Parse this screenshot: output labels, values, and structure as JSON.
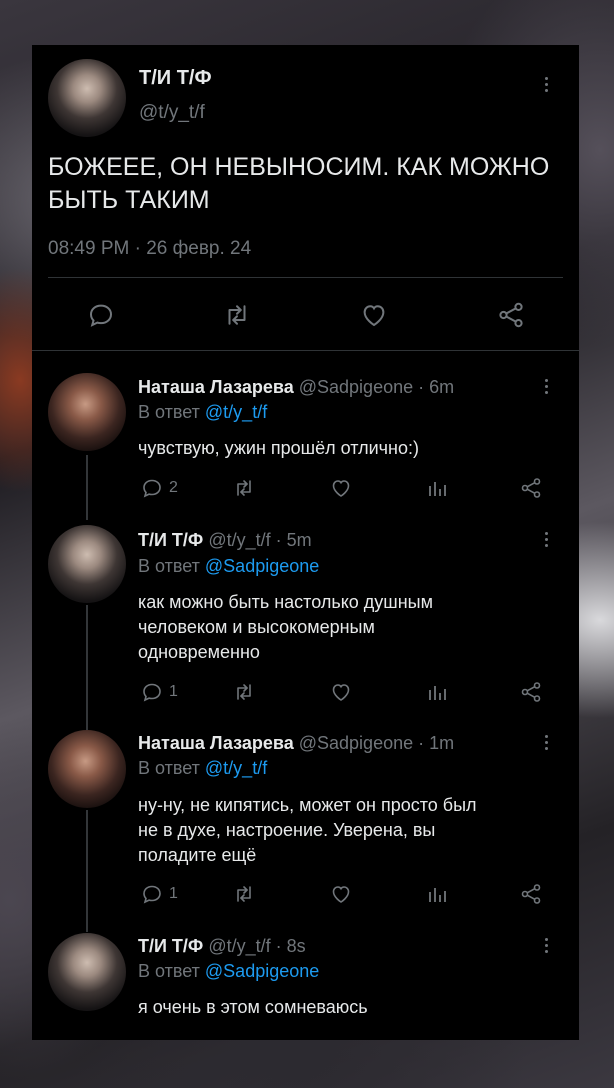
{
  "main_tweet": {
    "author": "Т/И Т/Ф",
    "handle": "@t/y_t/f",
    "text_line1": "БОЖЕЕЕ, ОН НЕВЫНОСИМ. КАК МОЖНО",
    "text_line2": "БЫТЬ ТАКИМ",
    "timestamp": "08:49 PM · 26 февр. 24",
    "actions": [
      "reply-icon",
      "retweet-icon",
      "like-icon",
      "share-icon"
    ]
  },
  "replies": [
    {
      "author": "Наташа Лазарева",
      "handle": "@Sadpigeone",
      "time": "· 6m",
      "reply_prefix": "В ответ",
      "reply_to": "@t/y_t/f",
      "text": "чувствую, ужин прошёл отлично:)",
      "reply_count": "2"
    },
    {
      "author": "Т/И Т/Ф",
      "handle": "@t/y_t/f",
      "time": "· 5m",
      "reply_prefix": "В ответ",
      "reply_to": "@Sadpigeone",
      "text_lines": [
        "как можно быть настолько душным",
        "человеком и высокомерным",
        "одновременно"
      ],
      "reply_count": "1"
    },
    {
      "author": "Наташа Лазарева",
      "handle": "@Sadpigeone",
      "time": "· 1m",
      "reply_prefix": "В ответ",
      "reply_to": "@t/y_t/f",
      "text_lines": [
        "ну-ну, не кипятись, может он просто был",
        "не в духе, настроение. Уверена, вы",
        "поладите ещё"
      ],
      "reply_count": "1"
    },
    {
      "author": "Т/И Т/Ф",
      "handle": "@t/y_t/f",
      "time": "· 8s",
      "reply_prefix": "В ответ",
      "reply_to": "@Sadpigeone",
      "text": "я очень в этом сомневаюсь"
    }
  ],
  "colors": {
    "background": "#000000",
    "text": "#e7e9ea",
    "muted": "#71767b",
    "link": "#1d9bf0"
  }
}
